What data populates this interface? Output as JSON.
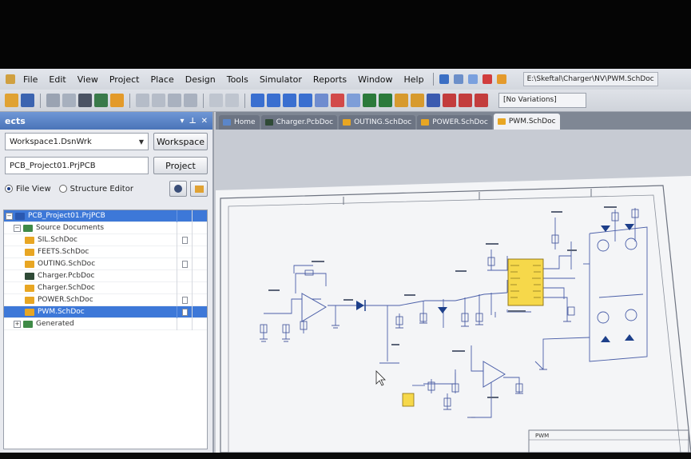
{
  "menu": {
    "items": [
      "Edit",
      "View",
      "Project",
      "Place",
      "Design",
      "Tools",
      "Simulator",
      "Reports",
      "Window",
      "Help"
    ],
    "path": "E:\\Skeftal\\Charger\\NV\\PWM.SchDoc"
  },
  "toolbar": {
    "variations": "[No Variations]"
  },
  "panel": {
    "workspace_value": "Workspace1.DsnWrk",
    "workspace_button": "Workspace",
    "project_value": "PCB_Project01.PrjPCB",
    "project_button": "Project",
    "file_view_label": "File View",
    "structure_editor_label": "Structure Editor",
    "tree": [
      {
        "label": "PCB_Project01.PrjPCB",
        "type": "project",
        "selected": true
      },
      {
        "label": "Source Documents",
        "type": "folder"
      },
      {
        "label": "SIL.SchDoc",
        "type": "sch"
      },
      {
        "label": "FEETS.SchDoc",
        "type": "sch"
      },
      {
        "label": "OUTING.SchDoc",
        "type": "sch"
      },
      {
        "label": "Charger.PcbDoc",
        "type": "pcb"
      },
      {
        "label": "Charger.SchDoc",
        "type": "sch"
      },
      {
        "label": "POWER.SchDoc",
        "type": "sch"
      },
      {
        "label": "PWM.SchDoc",
        "type": "sch",
        "selected": true
      },
      {
        "label": "Generated",
        "type": "folder"
      }
    ]
  },
  "tabs": [
    {
      "label": "Home",
      "color": "#5b86c9"
    },
    {
      "label": "Charger.PcbDoc",
      "color": "#2f4a36"
    },
    {
      "label": "OUTING.SchDoc",
      "color": "#e8a623"
    },
    {
      "label": "POWER.SchDoc",
      "color": "#e8a623"
    },
    {
      "label": "PWM.SchDoc",
      "color": "#e8a623",
      "active": true
    }
  ],
  "sheet": {
    "title_block_label": "PWM"
  }
}
